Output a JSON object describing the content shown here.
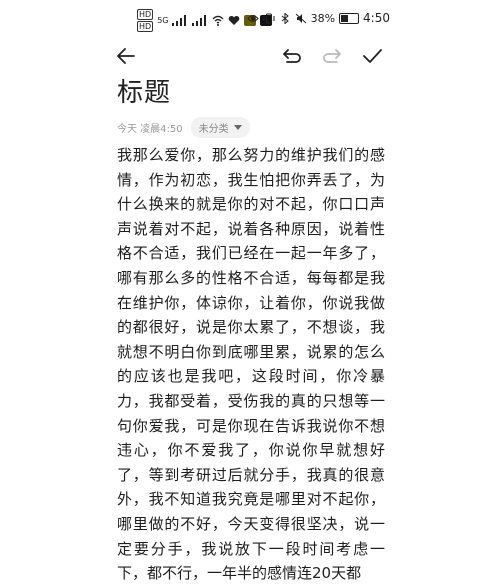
{
  "status": {
    "left_chips": [
      "HD",
      "HD"
    ],
    "left_tag": "5G",
    "battery": "38%",
    "time": "4:50"
  },
  "note": {
    "title": "标题",
    "date": "今天 凌晨4:50",
    "category": "未分类",
    "body": "我那么爱你，那么努力的维护我们的感情，作为初恋，我生怕把你弄丢了，为什么换来的就是你的对不起，你口口声声说着对不起，说着各种原因，说着性格不合适，我们已经在一起一年多了，哪有那么多的性格不合适，每每都是我在维护你，体谅你，让着你，你说我做的都很好，说是你太累了，不想谈，我就想不明白你到底哪里累，说累的怎么的应该也是我吧，这段时间，你冷暴力，我都受着，受伤我的真的只想等一句你爱我，可是你现在告诉我说你不想违心，你不爱我了，你说你早就想好了，等到考研过后就分手，我真的很意外，我不知道我究竟是哪里对不起你，哪里做的不好，今天变得很坚决，说一定要分手，我说放下一段时间考虑一下，都不行，一年半的感情连20天都"
  },
  "icons": {
    "back": "arrow-left-icon",
    "undo": "undo-icon",
    "redo": "redo-icon",
    "confirm": "check-icon"
  }
}
